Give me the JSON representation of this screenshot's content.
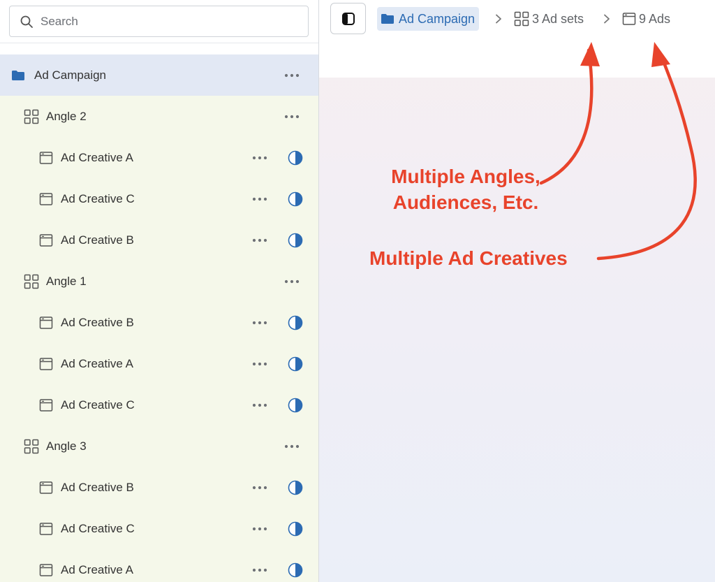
{
  "search": {
    "placeholder": "Search"
  },
  "tree": {
    "campaign": {
      "label": "Ad Campaign",
      "icon": "folder-icon"
    },
    "rows": [
      {
        "type": "angle",
        "label": "Angle 2"
      },
      {
        "type": "ad",
        "label": "Ad Creative A"
      },
      {
        "type": "ad",
        "label": "Ad Creative C"
      },
      {
        "type": "ad",
        "label": "Ad Creative B"
      },
      {
        "type": "angle",
        "label": "Angle 1"
      },
      {
        "type": "ad",
        "label": "Ad Creative B"
      },
      {
        "type": "ad",
        "label": "Ad Creative A"
      },
      {
        "type": "ad",
        "label": "Ad Creative C"
      },
      {
        "type": "angle",
        "label": "Angle 3"
      },
      {
        "type": "ad",
        "label": "Ad Creative B"
      },
      {
        "type": "ad",
        "label": "Ad Creative C"
      },
      {
        "type": "ad",
        "label": "Ad Creative A"
      }
    ]
  },
  "breadcrumb": {
    "campaign": "Ad Campaign",
    "adsets": "3 Ad sets",
    "ads": "9 Ads"
  },
  "annotations": {
    "angles_line1": "Multiple Angles,",
    "angles_line2": "Audiences, Etc.",
    "creatives": "Multiple Ad Creatives"
  },
  "colors": {
    "accent_blue": "#2c6bb3",
    "annotation_red": "#e8432b",
    "tree_bg": "#f5f8ea",
    "selected_bg": "#e2e8f4"
  }
}
